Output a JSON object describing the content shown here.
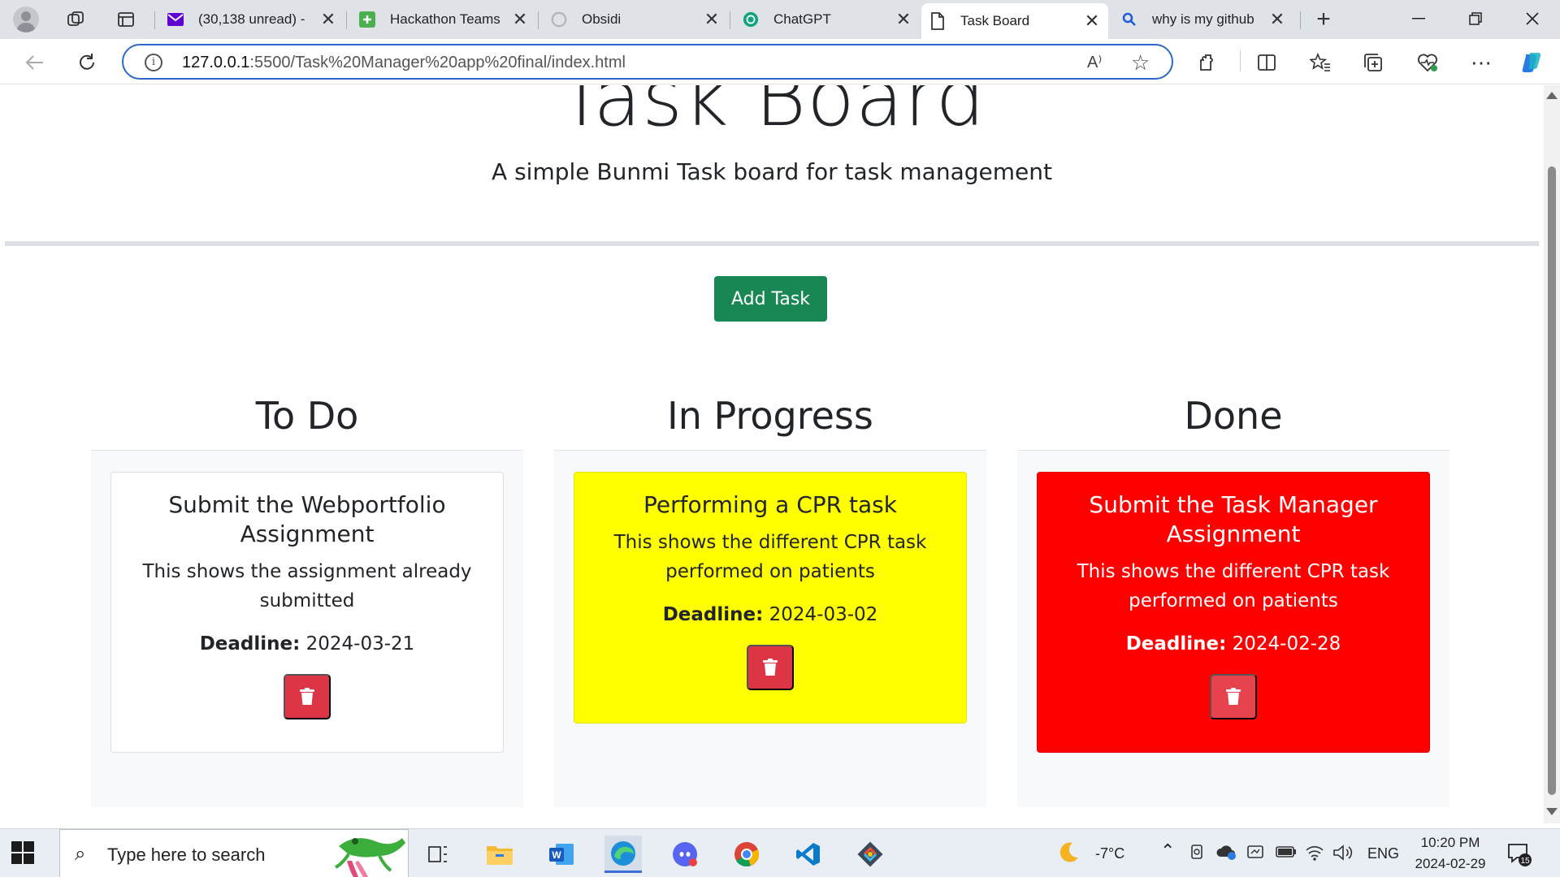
{
  "browser": {
    "tabs": [
      {
        "title": "(30,138 unread) -",
        "active": false
      },
      {
        "title": "Hackathon Teams",
        "active": false
      },
      {
        "title": "Obsidi",
        "active": false
      },
      {
        "title": "ChatGPT",
        "active": false
      },
      {
        "title": "Task Board",
        "active": true
      },
      {
        "title": "why is my github",
        "active": false
      }
    ],
    "url_host": "127.0.0.1",
    "url_path": ":5500/Task%20Manager%20app%20final/index.html",
    "read_aloud_label": "A⁾"
  },
  "page": {
    "title": "Task Board",
    "subtitle": "A simple Bunmi Task board for task management",
    "add_button": "Add Task",
    "lanes": [
      {
        "name": "To Do",
        "cards": [
          {
            "title": "Submit the Webportfolio Assignment",
            "description": "This shows the assignment already submitted",
            "deadline_label": "Deadline:",
            "deadline": "2024-03-21",
            "color": "#ffffff"
          }
        ]
      },
      {
        "name": "In Progress",
        "cards": [
          {
            "title": "Performing a CPR task",
            "description": "This shows the different CPR task performed on patients",
            "deadline_label": "Deadline:",
            "deadline": "2024-03-02",
            "color": "#ffff00"
          }
        ]
      },
      {
        "name": "Done",
        "cards": [
          {
            "title": "Submit the Task Manager Assignment",
            "description": "This shows the different CPR task performed on patients",
            "deadline_label": "Deadline:",
            "deadline": "2024-02-28",
            "color": "#ff0000"
          }
        ]
      }
    ],
    "colors": {
      "add_button": "#198754",
      "delete_button": "#dc3545"
    }
  },
  "taskbar": {
    "search_placeholder": "Type here to search",
    "weather": "-7°C",
    "language": "ENG",
    "time": "10:20 PM",
    "date": "2024-02-29",
    "notification_count": "15"
  }
}
